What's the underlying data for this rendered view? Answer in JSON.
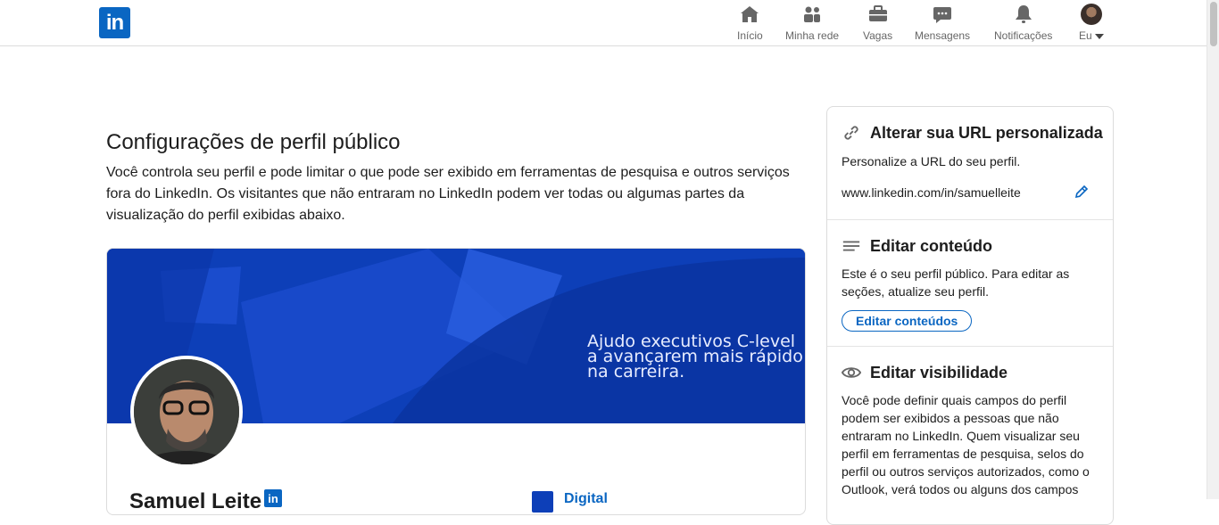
{
  "nav": {
    "logo": "in",
    "items": [
      {
        "label": "Início",
        "icon": "home-icon"
      },
      {
        "label": "Minha rede",
        "icon": "network-icon"
      },
      {
        "label": "Vagas",
        "icon": "briefcase-icon"
      },
      {
        "label": "Mensagens",
        "icon": "messages-icon"
      },
      {
        "label": "Notificações",
        "icon": "bell-icon"
      },
      {
        "label": "Eu",
        "icon": "avatar"
      }
    ]
  },
  "main": {
    "title": "Configurações de perfil público",
    "intro": "Você controla seu perfil e pode limitar o que pode ser exibido em ferramentas de pesquisa e outros serviços fora do LinkedIn. Os visitantes que não entraram no LinkedIn podem ver todas ou algumas partes da visualização do perfil exibidas abaixo.",
    "banner_text": [
      "Ajudo executivos C-level",
      "a avançarem mais rápido",
      "na carreira."
    ],
    "profile_name": "Samuel Leite",
    "company": "Digital",
    "mini_logo": "in"
  },
  "sidebar": {
    "url": {
      "title": "Alterar sua URL personalizada",
      "text": "Personalize a URL do seu perfil.",
      "value": "www.linkedin.com/in/samuelleite"
    },
    "content": {
      "title": "Editar conteúdo",
      "text": "Este é o seu perfil público. Para editar as seções, atualize seu perfil.",
      "button": "Editar conteúdos"
    },
    "visibility": {
      "title": "Editar visibilidade",
      "text": "Você pode definir quais campos do perfil podem ser exibidos a pessoas que não entraram no LinkedIn. Quem visualizar seu perfil em ferramentas de pesquisa, selos do perfil ou outros serviços autorizados, como o Outlook, verá todos ou alguns dos campos"
    }
  },
  "colors": {
    "brand": "#0a66c2",
    "banner": "#0d3fb8"
  }
}
